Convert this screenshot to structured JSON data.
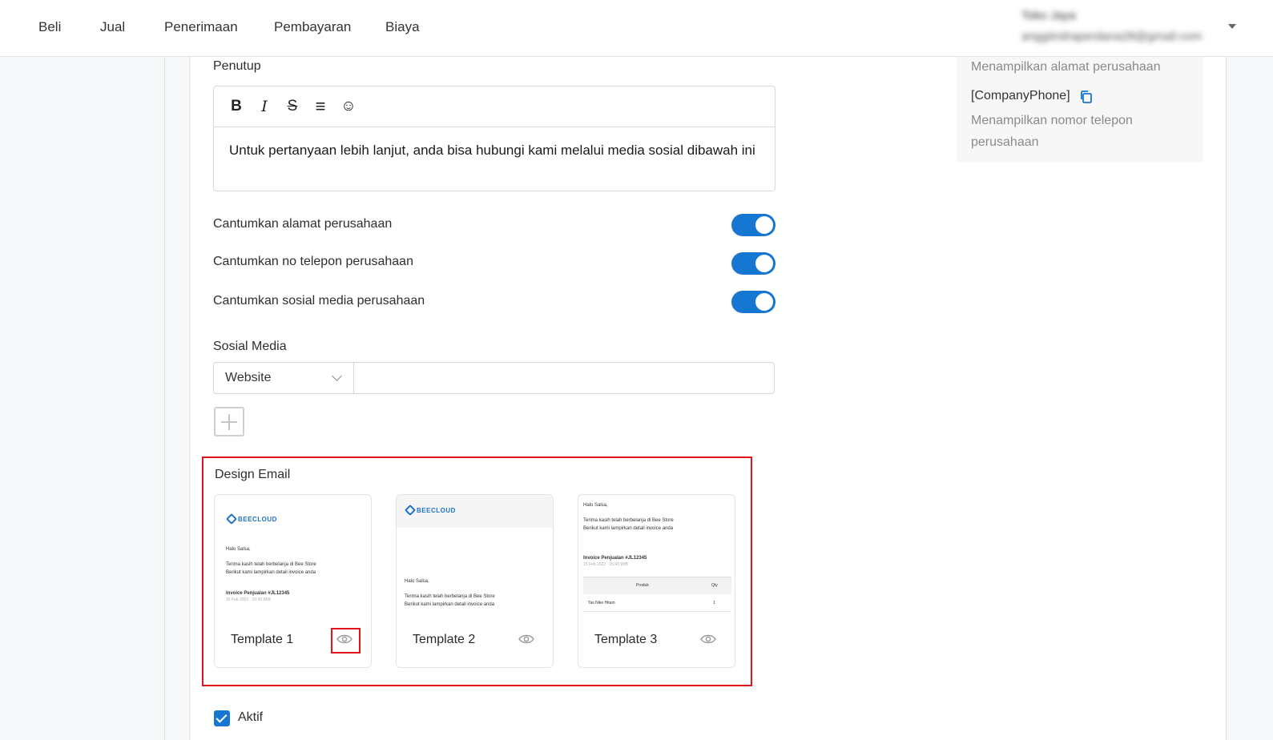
{
  "nav": {
    "items": [
      {
        "label": "Beli"
      },
      {
        "label": "Jual"
      },
      {
        "label": "Penerimaan"
      },
      {
        "label": "Pembayaran"
      },
      {
        "label": "Biaya"
      }
    ],
    "user": {
      "name": "Toko Jaya",
      "email": "anggiindraperdana28@gmail.com"
    }
  },
  "placeholders": {
    "address_desc": "Menampilkan alamat perusahaan",
    "phone_code": "[CompanyPhone]",
    "phone_desc_1": "Menampilkan nomor telepon",
    "phone_desc_2": "perusahaan"
  },
  "closing": {
    "label": "Penutup",
    "toolbar": {
      "bold": "B",
      "italic": "I",
      "strike": "S",
      "align": "≡",
      "emoji": "☺"
    },
    "text": "Untuk pertanyaan lebih lanjut, anda bisa hubungi kami melalui media sosial dibawah ini"
  },
  "toggles": [
    {
      "label": "Cantumkan alamat perusahaan",
      "on": true
    },
    {
      "label": "Cantumkan no telepon perusahaan",
      "on": true
    },
    {
      "label": "Cantumkan sosial media perusahaan",
      "on": true
    }
  ],
  "social": {
    "label": "Sosial Media",
    "selected": "Website",
    "value": ""
  },
  "design": {
    "label": "Design Email",
    "templates": [
      {
        "label": "Template 1"
      },
      {
        "label": "Template 2"
      },
      {
        "label": "Template 3"
      }
    ],
    "preview": {
      "brand": "BEECLOUD",
      "greeting": "Halo Salsa,",
      "line1": "Terima kasih telah berbelanja di Bee Store",
      "line2": "Berikut kami lampirkan detail invoice anda",
      "invoice": "Invoice Penjualan #JL12345",
      "date": "15 Feb 2022 · 15:43 WIB",
      "col_product": "Produk",
      "col_qty": "Qty",
      "row_product": "Tas Nike Hitam",
      "row_qty": "1"
    }
  },
  "active": {
    "label": "Aktif",
    "checked": true
  },
  "colors": {
    "accent": "#1677d2",
    "highlight": "#e0141b"
  }
}
